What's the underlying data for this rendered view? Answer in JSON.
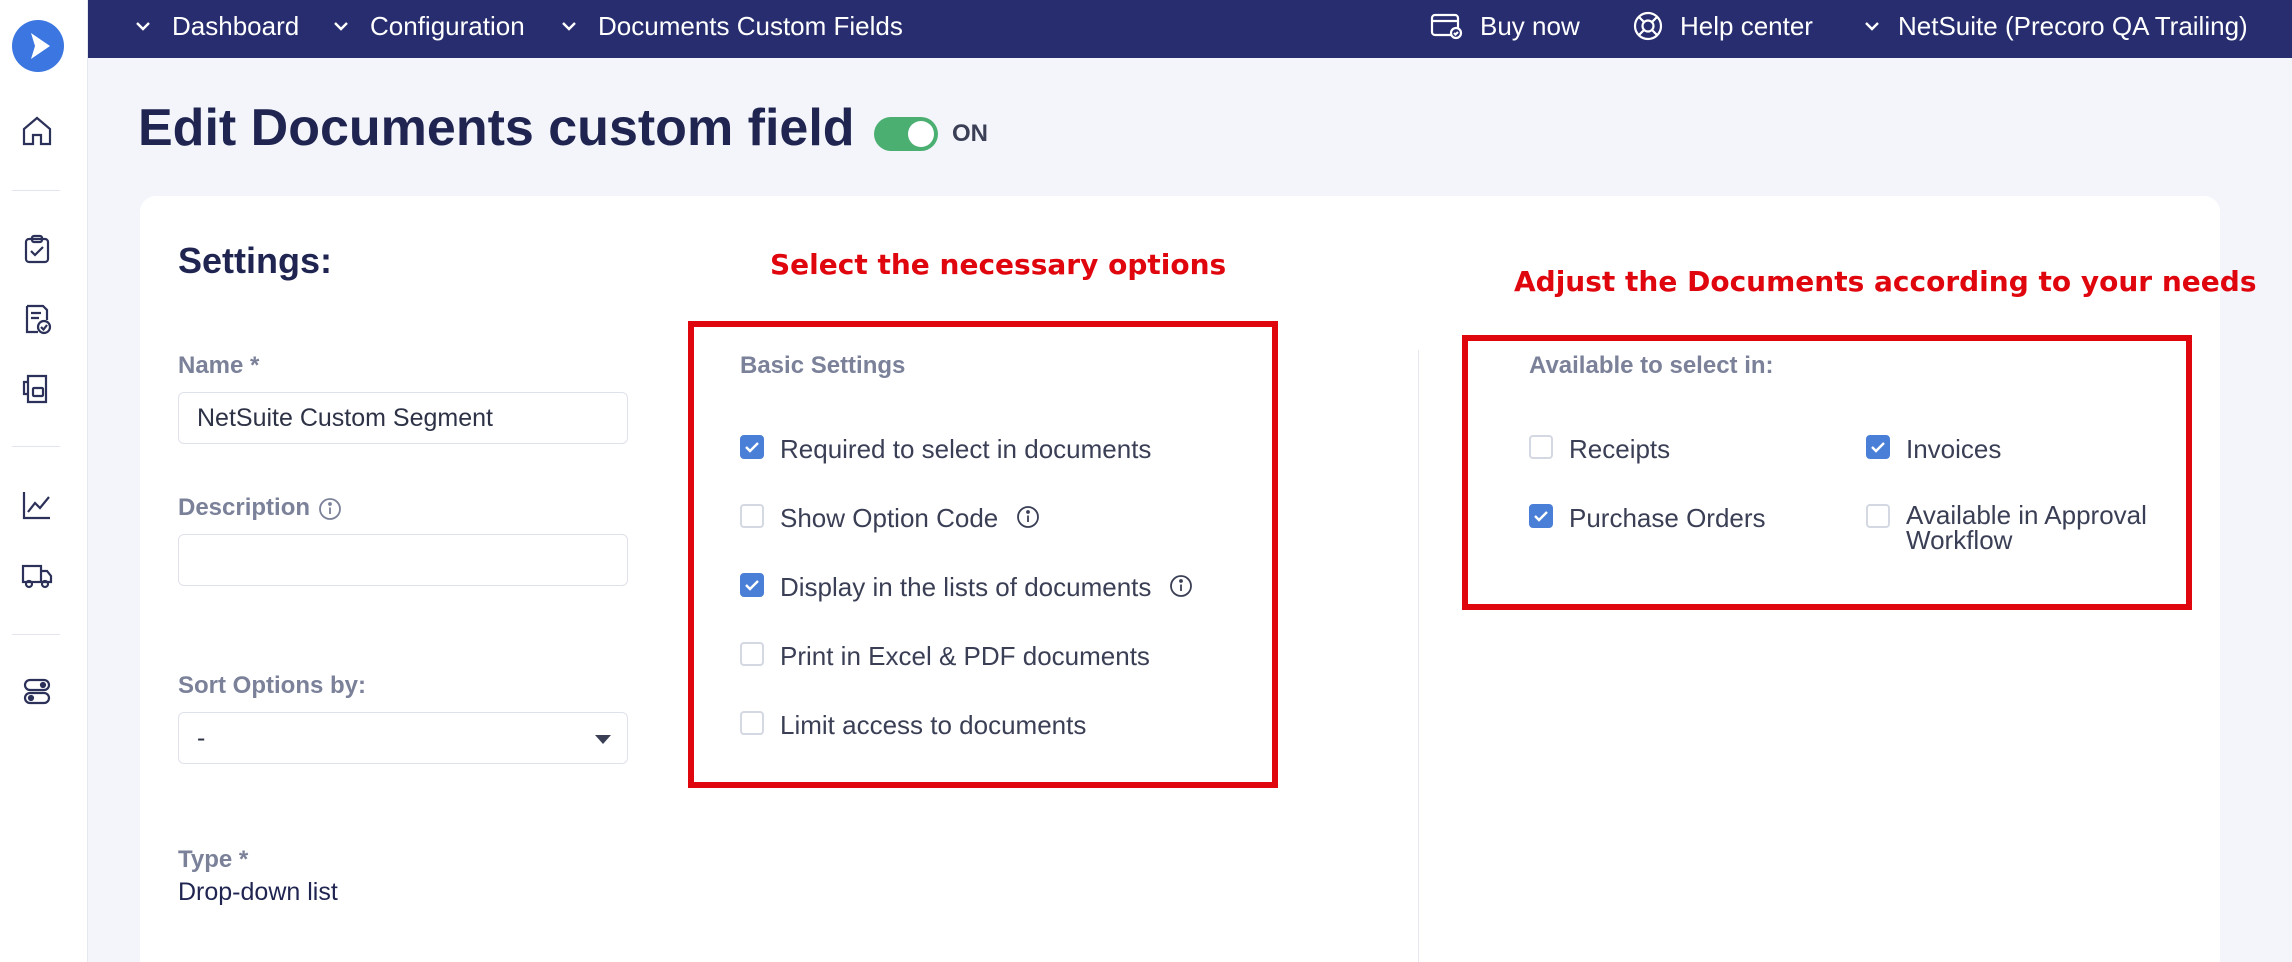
{
  "topbar": {
    "breadcrumbs": [
      "Dashboard",
      "Configuration",
      "Documents Custom Fields"
    ],
    "buy_now": "Buy now",
    "help_center": "Help center",
    "company": "NetSuite (Precoro QA Trailing)"
  },
  "page": {
    "title": "Edit Documents custom field",
    "toggle_label": "ON",
    "toggle_on": true
  },
  "settings": {
    "title": "Settings:",
    "name_label": "Name *",
    "name_value": "NetSuite Custom Segment",
    "description_label": "Description",
    "description_value": "",
    "sort_label": "Sort Options by:",
    "sort_value": "-",
    "type_label": "Type *",
    "type_value": "Drop-down list"
  },
  "basic_settings": {
    "label": "Basic Settings",
    "options": [
      {
        "label": "Required to select in documents",
        "checked": true,
        "info": false
      },
      {
        "label": "Show Option Code",
        "checked": false,
        "info": true
      },
      {
        "label": "Display in the lists of documents",
        "checked": true,
        "info": true
      },
      {
        "label": "Print in Excel & PDF documents",
        "checked": false,
        "info": false
      },
      {
        "label": "Limit access to documents",
        "checked": false,
        "info": false
      }
    ]
  },
  "available": {
    "label": "Available to select in:",
    "options": [
      {
        "label": "Receipts",
        "checked": false
      },
      {
        "label": "Invoices",
        "checked": true
      },
      {
        "label": "Purchase Orders",
        "checked": true
      },
      {
        "label": "Available in Approval Workflow",
        "checked": false
      }
    ]
  },
  "annotations": {
    "left": "Select the necessary options",
    "right": "Adjust the Documents according to your needs",
    "color": "#e0060e"
  },
  "colors": {
    "topbar": "#272d6e",
    "accent": "#4a7fd8",
    "toggle": "#4caf72"
  }
}
